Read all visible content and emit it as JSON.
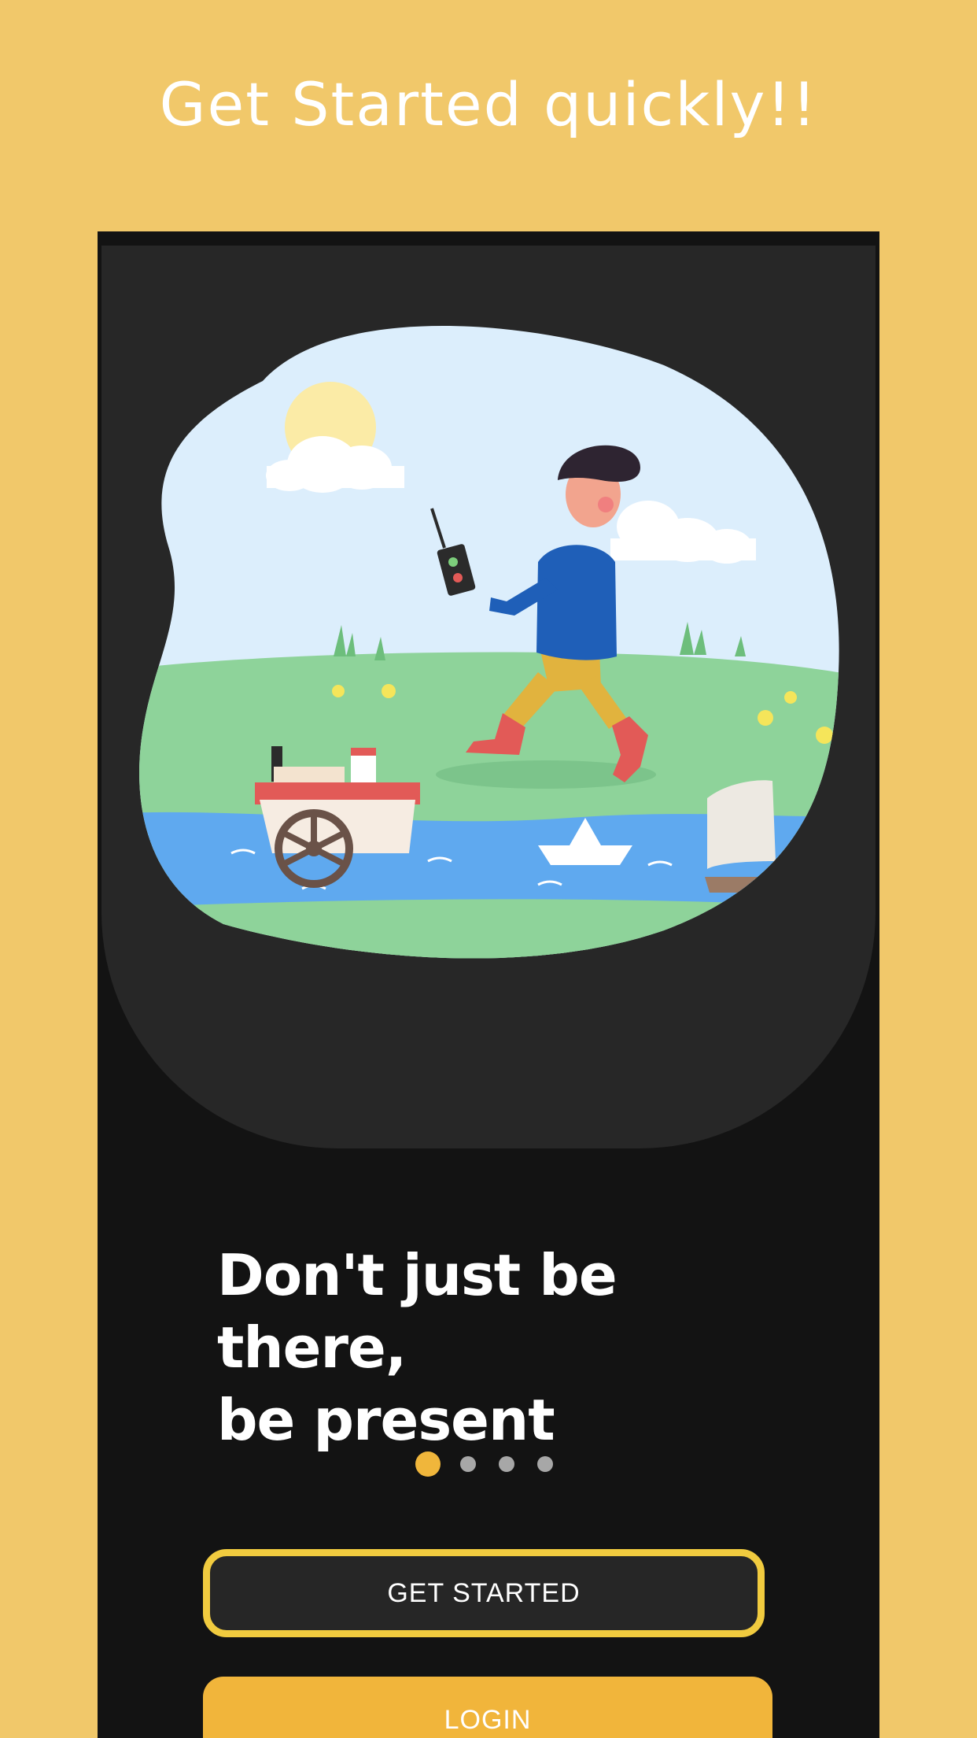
{
  "promo": {
    "title": "Get Started quickly!!"
  },
  "onboarding": {
    "headline_line1": "Don't just be there,",
    "headline_line2": "be present",
    "pager": {
      "total": 4,
      "active_index": 0
    },
    "get_started_label": "GET STARTED",
    "login_label": "LOGIN"
  },
  "colors": {
    "page_background": "#F1C86A",
    "phone_background": "#131313",
    "panel_background": "#272727",
    "accent": "#F0B63B",
    "button_border": "#F1CB3F"
  },
  "illustration": {
    "subject": "boy-with-remote-control-boat-icon"
  }
}
